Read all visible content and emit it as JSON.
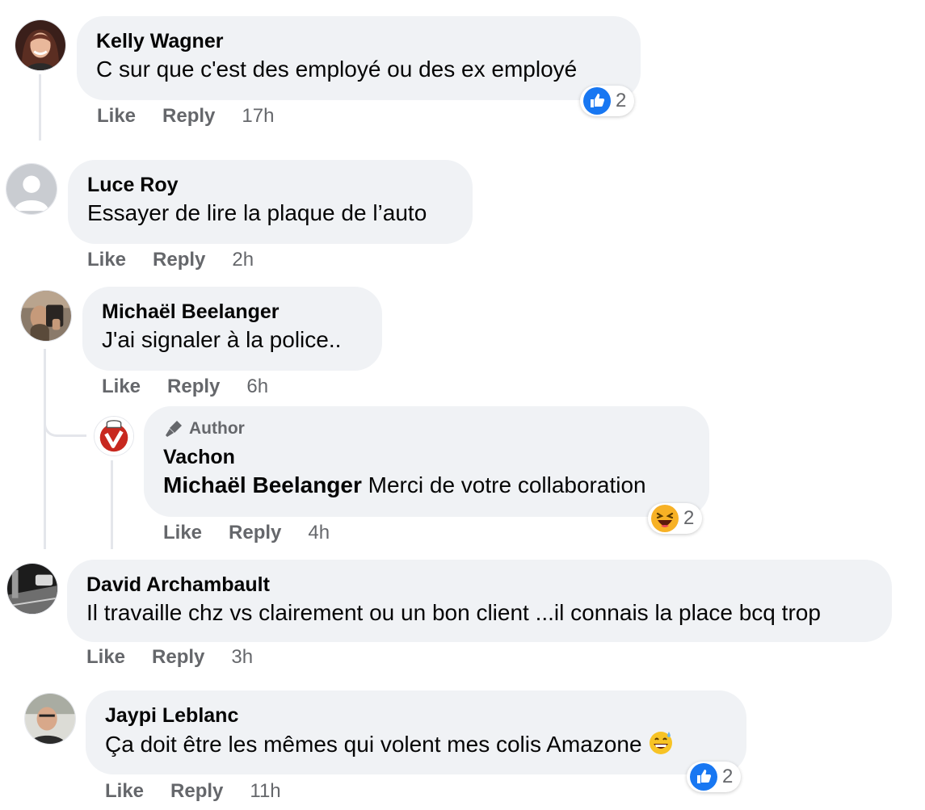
{
  "comments": [
    {
      "name": "Kelly Wagner",
      "text": "C sur que c'est des employé ou des ex employé",
      "like": "Like",
      "reply": "Reply",
      "time": "17h",
      "reaction": {
        "type": "like",
        "count": "2"
      }
    },
    {
      "name": "Luce Roy",
      "text": "Essayer de lire la plaque de l’auto",
      "like": "Like",
      "reply": "Reply",
      "time": "2h"
    },
    {
      "name": "Michaël Beelanger",
      "text": "J'ai signaler à la police..",
      "like": "Like",
      "reply": "Reply",
      "time": "6h",
      "replies": [
        {
          "badge": "Author",
          "name": "Vachon",
          "mention": "Michaël Beelanger",
          "text": "Merci de votre collaboration",
          "like": "Like",
          "reply": "Reply",
          "time": "4h",
          "reaction": {
            "type": "haha",
            "count": "2"
          }
        }
      ]
    },
    {
      "name": "David Archambault",
      "text": "Il travaille chz vs clairement ou un bon client ...il connais la place bcq trop",
      "like": "Like",
      "reply": "Reply",
      "time": "3h"
    },
    {
      "name": "Jaypi Leblanc",
      "text": "Ça doit être les mêmes qui volent mes colis Amazone",
      "emoji": "grinning-sweat-emoji",
      "like": "Like",
      "reply": "Reply",
      "time": "11h",
      "reaction": {
        "type": "like",
        "count": "2"
      }
    }
  ],
  "colors": {
    "bubble": "#f0f2f5",
    "secondary_text": "#65676b",
    "like_blue": "#1877f2",
    "haha_yellow": "#f7b125",
    "thread_line": "#e4e6eb"
  }
}
